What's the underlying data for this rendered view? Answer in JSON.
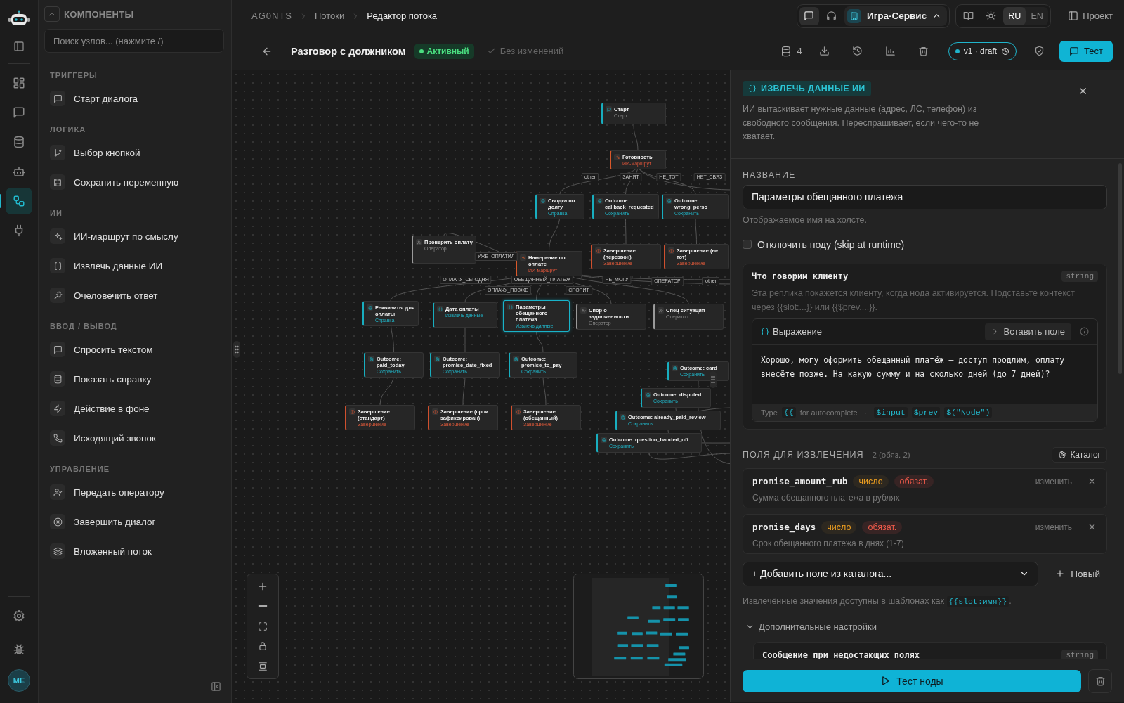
{
  "rail": {
    "nav": [
      {
        "selected": false
      },
      {
        "selected": false
      },
      {
        "selected": false
      },
      {
        "selected": false
      },
      {
        "selected": true
      },
      {
        "selected": false
      }
    ],
    "avatar": "ME"
  },
  "components": {
    "title": "КОМПОНЕНТЫ",
    "search": {
      "placeholder": "Поиск узлов... (нажмите /)"
    },
    "groups": [
      {
        "title": "ТРИГГЕРЫ",
        "items": [
          "Старт диалога"
        ]
      },
      {
        "title": "ЛОГИКА",
        "items": [
          "Выбор кнопкой",
          "Сохранить переменную"
        ]
      },
      {
        "title": "ИИ",
        "items": [
          "ИИ-маршрут по смыслу",
          "Извлечь данные ИИ",
          "Очеловечить ответ"
        ]
      },
      {
        "title": "ВВОД / ВЫВОД",
        "items": [
          "Спросить текстом",
          "Показать справку",
          "Действие в фоне",
          "Исходящий звонок"
        ]
      },
      {
        "title": "УПРАВЛЕНИЕ",
        "items": [
          "Передать оператору",
          "Завершить диалог",
          "Вложенный поток"
        ]
      }
    ]
  },
  "breadcrumb": [
    "AG0NTS",
    "Потоки",
    "Редактор потока"
  ],
  "channels": [
    {
      "selected": true
    },
    {
      "selected": false
    }
  ],
  "workspace": "Игра-Сервис",
  "languages": [
    {
      "label": "RU",
      "selected": true
    },
    {
      "label": "EN",
      "selected": false
    }
  ],
  "project_button": "Проект",
  "flow": {
    "title": "Разговор с должником",
    "status": "Активный",
    "save_state": "Без изменений",
    "count": "4",
    "version": "v1 · draft",
    "test_button": "Тест"
  },
  "canvas": {
    "nodes": [
      {
        "title": "Старт",
        "subtitle": "Старт",
        "kind": "start",
        "selected": false
      },
      {
        "title": "Готовность",
        "subtitle": "ИИ-маршрут",
        "kind": "router",
        "selected": false
      },
      {
        "title": "Сводка по долгу",
        "subtitle": "Справка",
        "kind": "info",
        "selected": false
      },
      {
        "title": "Outcome: callback_requested",
        "subtitle": "Сохранить",
        "kind": "save",
        "selected": false
      },
      {
        "title": "Outcome: wrong_perso",
        "subtitle": "Сохранить",
        "kind": "save",
        "selected": false
      },
      {
        "title": "Проверить оплату",
        "subtitle": "Оператор",
        "kind": "operator",
        "selected": false
      },
      {
        "title": "Намерение по оплате",
        "subtitle": "ИИ-маршрут",
        "kind": "router",
        "selected": false
      },
      {
        "title": "Завершение (перезвон)",
        "subtitle": "Завершение",
        "kind": "end",
        "selected": false
      },
      {
        "title": "Завершение (не тот)",
        "subtitle": "Завершение",
        "kind": "end",
        "selected": false
      },
      {
        "title": "Реквизиты для оплаты",
        "subtitle": "Справка",
        "kind": "info",
        "selected": false
      },
      {
        "title": "Дата оплаты",
        "subtitle": "Извлечь данные",
        "kind": "extract",
        "selected": false
      },
      {
        "title": "Параметры обещанного платежа",
        "subtitle": "Извлечь данные",
        "kind": "extract",
        "selected": true
      },
      {
        "title": "Спор о задолженности",
        "subtitle": "Оператор",
        "kind": "operator",
        "selected": false
      },
      {
        "title": "Спец ситуация",
        "subtitle": "Оператор",
        "kind": "operator",
        "selected": false
      },
      {
        "title": "Outcome: paid_today",
        "subtitle": "Сохранить",
        "kind": "save",
        "selected": false
      },
      {
        "title": "Outcome: promise_date_fixed",
        "subtitle": "Сохранить",
        "kind": "save",
        "selected": false
      },
      {
        "title": "Outcome: promise_to_pay",
        "subtitle": "Сохранить",
        "kind": "save",
        "selected": false
      },
      {
        "title": "Завершение (стандарт)",
        "subtitle": "Завершение",
        "kind": "end",
        "selected": false
      },
      {
        "title": "Завершение (срок зафиксирован)",
        "subtitle": "Завершение",
        "kind": "end",
        "selected": false
      },
      {
        "title": "Завершение (обещанный)",
        "subtitle": "Завершение",
        "kind": "end",
        "selected": false
      },
      {
        "title": "Outcome: card_",
        "subtitle": "Сохранить",
        "kind": "save",
        "selected": false
      },
      {
        "title": "Outcome: disputed",
        "subtitle": "Сохранить",
        "kind": "save",
        "selected": false
      },
      {
        "title": "Outcome: already_paid_review",
        "subtitle": "Сохранить",
        "kind": "save",
        "selected": false
      },
      {
        "title": "Outcome: question_handed_off",
        "subtitle": "Сохранить",
        "kind": "save",
        "selected": false
      }
    ],
    "edge_labels": [
      "other",
      "ЗАНЯТ",
      "НЕ_ТОТ",
      "НЕТ_СВЯЗ",
      "УЖЕ_ОПЛАТИЛ",
      "ОПЛАЧУ_СЕГОДНЯ",
      "ОПЛАЧУ_ПОЗЖЕ",
      "ОБЕЩАННЫЙ_ПЛАТЕЖ",
      "СПОРИТ",
      "НЕ_МОГУ",
      "ОПЕРАТОР",
      "other"
    ]
  },
  "panel": {
    "badge": "ИЗВЛЕЧЬ ДАННЫЕ ИИ",
    "description": "ИИ вытаскивает нужные данные (адрес, ЛС, телефон) из свободного сообщения. Переспрашивает, если чего-то не хватает.",
    "name_label": "НАЗВАНИЕ",
    "name_value": "Параметры обещанного платежа",
    "name_hint": "Отображаемое имя на холсте.",
    "disable_toggle": {
      "label": "Отключить ноду (skip at runtime)",
      "checked": false
    },
    "message_card": {
      "title": "Что говорим клиенту",
      "type": "string",
      "hint": "Эта реплика покажется клиенту, когда нода активируется. Подставьте контекст через {{slot:...}} или {{$prev....}}.",
      "editor_mode": "Выражение",
      "insert_button": "Вставить поле",
      "value": "Хорошо, могу оформить обещанный платёж — доступ продлим, оплату внесёте позже. На какую сумму и на сколько дней (до 7 дней)?",
      "footer_type": "Type",
      "footer_braces": "{{",
      "footer_hint": "for autocomplete",
      "footer_separator": "·",
      "tokens": [
        "$input",
        "$prev",
        "$(\"Node\")"
      ]
    },
    "fields_title": "ПОЛЯ ДЛЯ ИЗВЛЕЧЕНИЯ",
    "fields_count": "2 (обяз. 2)",
    "catalog_button": "Каталог",
    "fields": [
      {
        "name": "promise_amount_rub",
        "type": "число",
        "required": true,
        "required_label": "обязат.",
        "description": "Сумма обещанного платежа в рублях",
        "edit": "изменить"
      },
      {
        "name": "promise_days",
        "type": "число",
        "required": true,
        "required_label": "обязат.",
        "description": "Срок обещанного платежа в днях (1-7)",
        "edit": "изменить"
      }
    ],
    "add_select": "+ Добавить поле из каталога...",
    "new_button": "Новый",
    "slot_hint": "Извлечённые значения доступны в шаблонах как",
    "slot_token": "{{slot:имя}}",
    "slot_hint_end": ".",
    "advanced": {
      "label": "Дополнительные настройки",
      "expanded": true,
      "card_title": "Сообщение при недостающих полях",
      "card_type": "string"
    },
    "test_button": "Тест ноды"
  }
}
